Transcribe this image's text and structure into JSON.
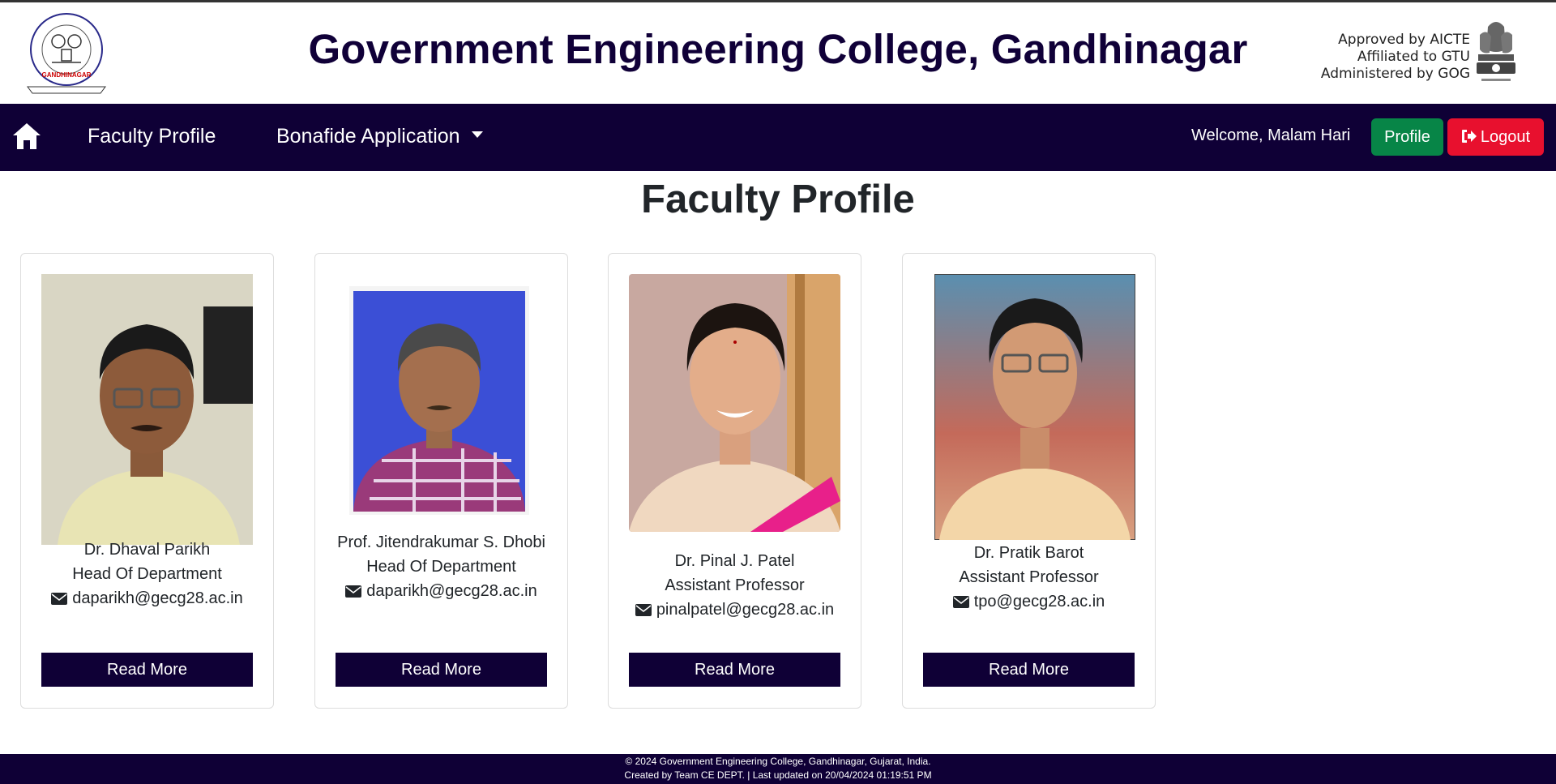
{
  "header": {
    "title": "Government Engineering College, Gandhinagar",
    "logo_text_top": "GOVERNMENT ENGINEERING COLLEGE",
    "logo_text_bottom": "GANDHINAGAR",
    "approval_lines": [
      "Approved by AICTE",
      "Affiliated to GTU",
      "Administered by GOG"
    ]
  },
  "nav": {
    "home_icon": "home-icon",
    "items": [
      {
        "label": "Faculty Profile"
      },
      {
        "label": "Bonafide Application"
      }
    ],
    "welcome": "Welcome, Malam Hari",
    "profile_button": "Profile",
    "logout_button": "Logout"
  },
  "page": {
    "heading": "Faculty Profile"
  },
  "faculty": [
    {
      "name": "Dr. Dhaval Parikh",
      "designation": "Head Of Department",
      "email": "daparikh@gecg28.ac.in",
      "button": "Read More"
    },
    {
      "name": "Prof. Jitendrakumar S. Dhobi",
      "designation": "Head Of Department",
      "email": "daparikh@gecg28.ac.in",
      "button": "Read More"
    },
    {
      "name": "Dr. Pinal J. Patel",
      "designation": "Assistant Professor",
      "email": "pinalpatel@gecg28.ac.in",
      "button": "Read More"
    },
    {
      "name": "Dr. Pratik Barot",
      "designation": "Assistant Professor",
      "email": "tpo@gecg28.ac.in",
      "button": "Read More"
    }
  ],
  "footer": {
    "line1": "© 2024 Government Engineering College, Gandhinagar, Gujarat, India.",
    "line2": "Created by Team CE DEPT. | Last updated on 20/04/2024 01:19:51 PM"
  },
  "colors": {
    "navy": "#0f0036",
    "title": "#100038",
    "profile_green": "#078547",
    "logout_red": "#e8102e"
  }
}
